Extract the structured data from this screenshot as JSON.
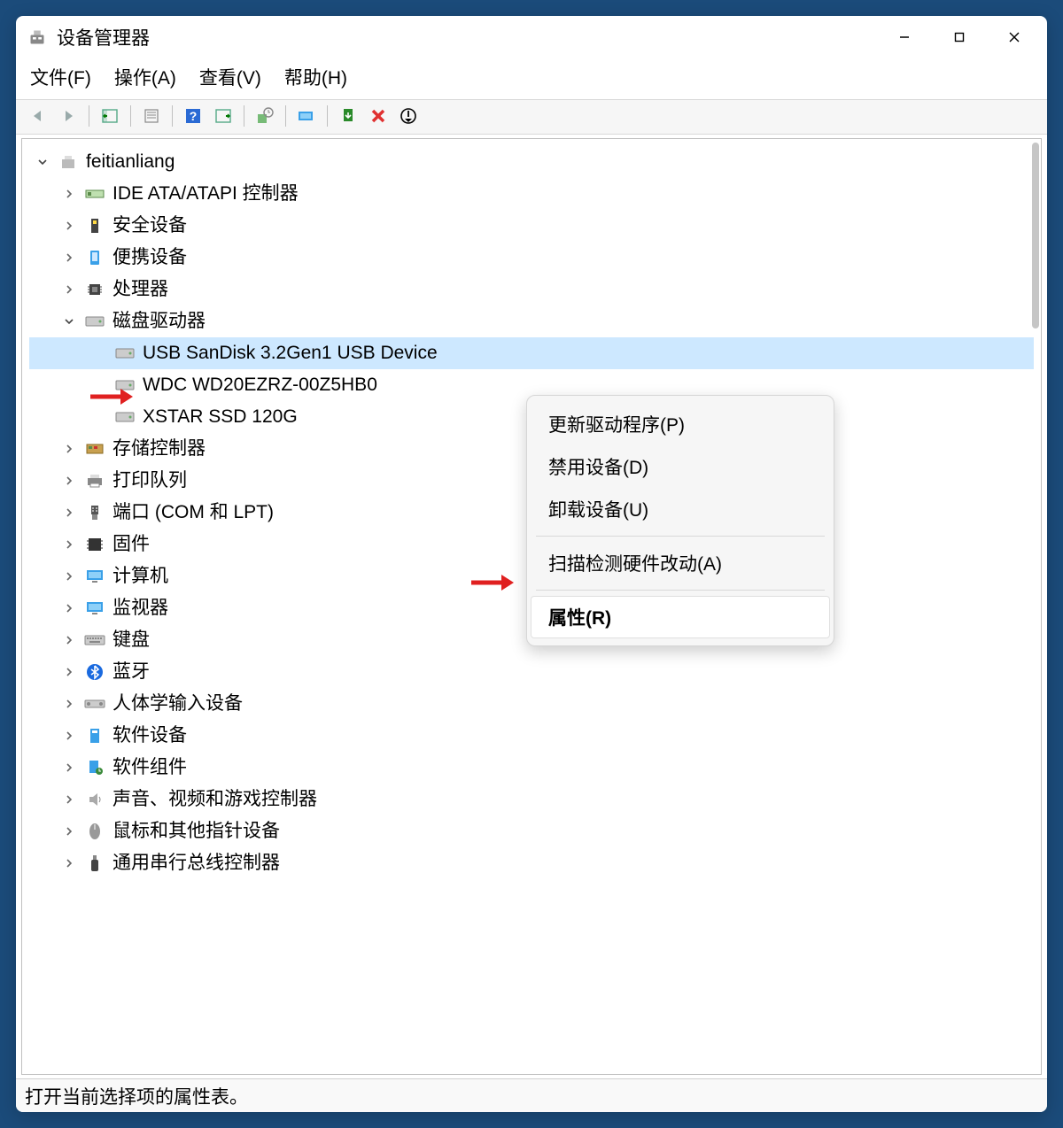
{
  "window": {
    "title": "设备管理器"
  },
  "menu": {
    "file": "文件(F)",
    "action": "操作(A)",
    "view": "查看(V)",
    "help": "帮助(H)"
  },
  "tree": {
    "root": "feitianliang",
    "cat_ide": "IDE ATA/ATAPI 控制器",
    "cat_security": "安全设备",
    "cat_portable": "便携设备",
    "cat_cpu": "处理器",
    "cat_disk": "磁盘驱动器",
    "disk_usb": "USB  SanDisk 3.2Gen1 USB Device",
    "disk_wdc": "WDC WD20EZRZ-00Z5HB0",
    "disk_xstar": "XSTAR   SSD  120G",
    "cat_storage": "存储控制器",
    "cat_print": "打印队列",
    "cat_ports": "端口 (COM 和 LPT)",
    "cat_firmware": "固件",
    "cat_computer": "计算机",
    "cat_monitor": "监视器",
    "cat_keyboard": "键盘",
    "cat_bluetooth": "蓝牙",
    "cat_hid": "人体学输入设备",
    "cat_softdev": "软件设备",
    "cat_softcomp": "软件组件",
    "cat_sound": "声音、视频和游戏控制器",
    "cat_mouse": "鼠标和其他指针设备",
    "cat_usb": "通用串行总线控制器"
  },
  "context_menu": {
    "update": "更新驱动程序(P)",
    "disable": "禁用设备(D)",
    "uninstall": "卸载设备(U)",
    "scan": "扫描检测硬件改动(A)",
    "properties": "属性(R)"
  },
  "status": "打开当前选择项的属性表。"
}
